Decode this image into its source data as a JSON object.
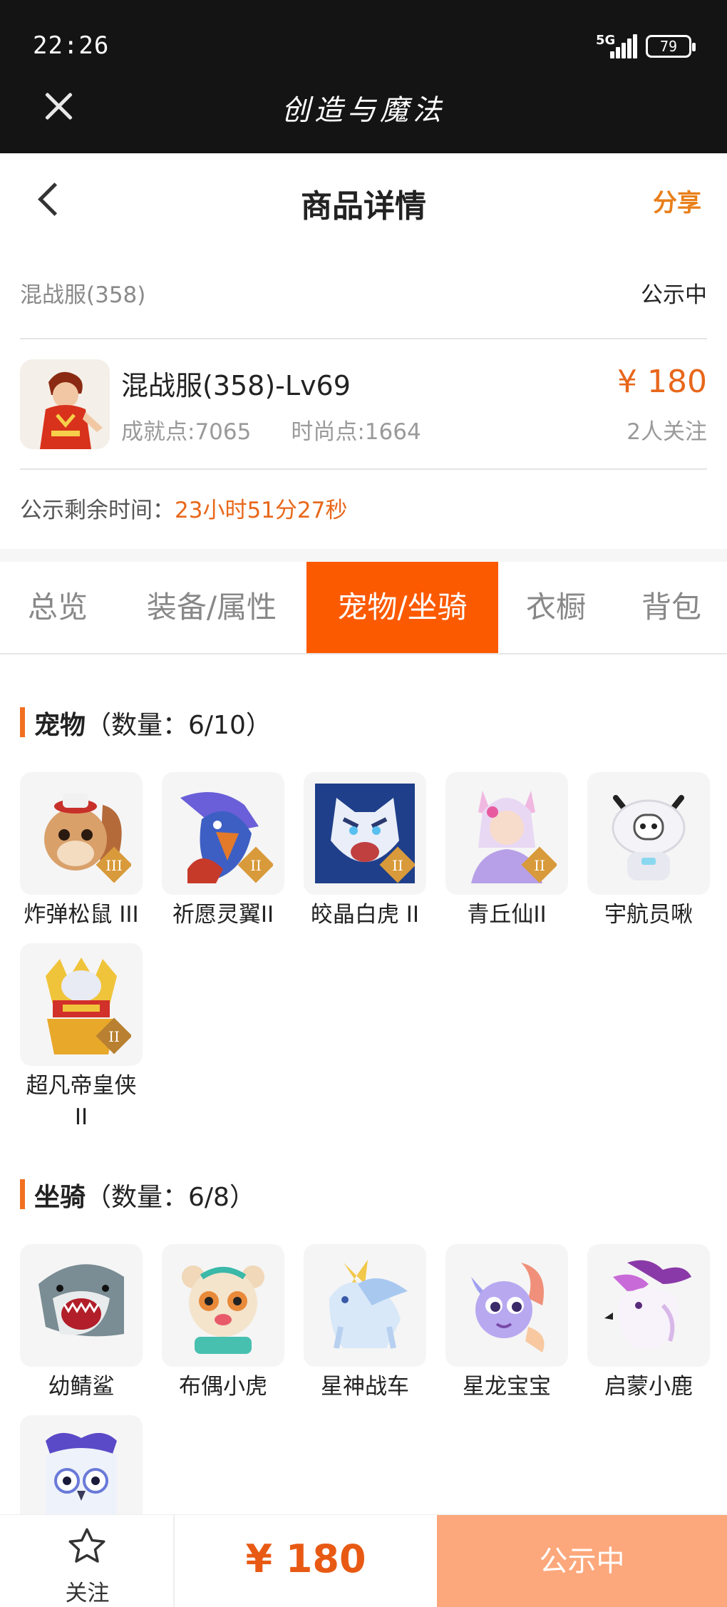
{
  "status_bar": {
    "time": "22:26",
    "network": "5G",
    "battery": "79"
  },
  "app_bar": {
    "title": "创造与魔法"
  },
  "header": {
    "title": "商品详情",
    "share_label": "分享"
  },
  "listing": {
    "server": "混战服(358)",
    "status": "公示中",
    "character_name": "混战服(358)-Lv69",
    "achievement_points": "成就点:7065",
    "fashion_points": "时尚点:1664",
    "price": "¥ 180",
    "followers": "2人关注",
    "countdown_label": "公示剩余时间：",
    "countdown_value": "23小时51分27秒"
  },
  "tabs": [
    {
      "label": "总览",
      "active": false
    },
    {
      "label": "装备/属性",
      "active": false
    },
    {
      "label": "宠物/坐骑",
      "active": true
    },
    {
      "label": "衣橱",
      "active": false
    },
    {
      "label": "背包",
      "active": false
    }
  ],
  "pets": {
    "title": "宠物",
    "count": "（数量：6/10）",
    "items": [
      {
        "label": "炸弹松鼠 III",
        "icon": "squirrel-icon"
      },
      {
        "label": "祈愿灵翼II",
        "icon": "eagle-icon"
      },
      {
        "label": "皎晶白虎 II",
        "icon": "tiger-icon"
      },
      {
        "label": "青丘仙II",
        "icon": "fox-fairy-icon"
      },
      {
        "label": "宇航员啾",
        "icon": "astronaut-icon"
      },
      {
        "label": "超凡帝皇侠II",
        "icon": "armored-hero-icon"
      }
    ]
  },
  "mounts": {
    "title": "坐骑",
    "count": "（数量：6/8）",
    "items": [
      {
        "label": "幼鲭鲨",
        "icon": "shark-icon"
      },
      {
        "label": "布偶小虎",
        "icon": "cub-icon"
      },
      {
        "label": "星神战车",
        "icon": "horse-icon"
      },
      {
        "label": "星龙宝宝",
        "icon": "dragon-icon"
      },
      {
        "label": "启蒙小鹿",
        "icon": "deer-icon"
      },
      {
        "label": "",
        "icon": "owl-icon"
      }
    ]
  },
  "bottom_bar": {
    "follow_label": "关注",
    "price": "¥ 180",
    "cta_label": "公示中"
  },
  "colors": {
    "accent": "#fc5a00",
    "price": "#e8671a",
    "cta": "#fca87c",
    "dark_bar": "#141414"
  }
}
